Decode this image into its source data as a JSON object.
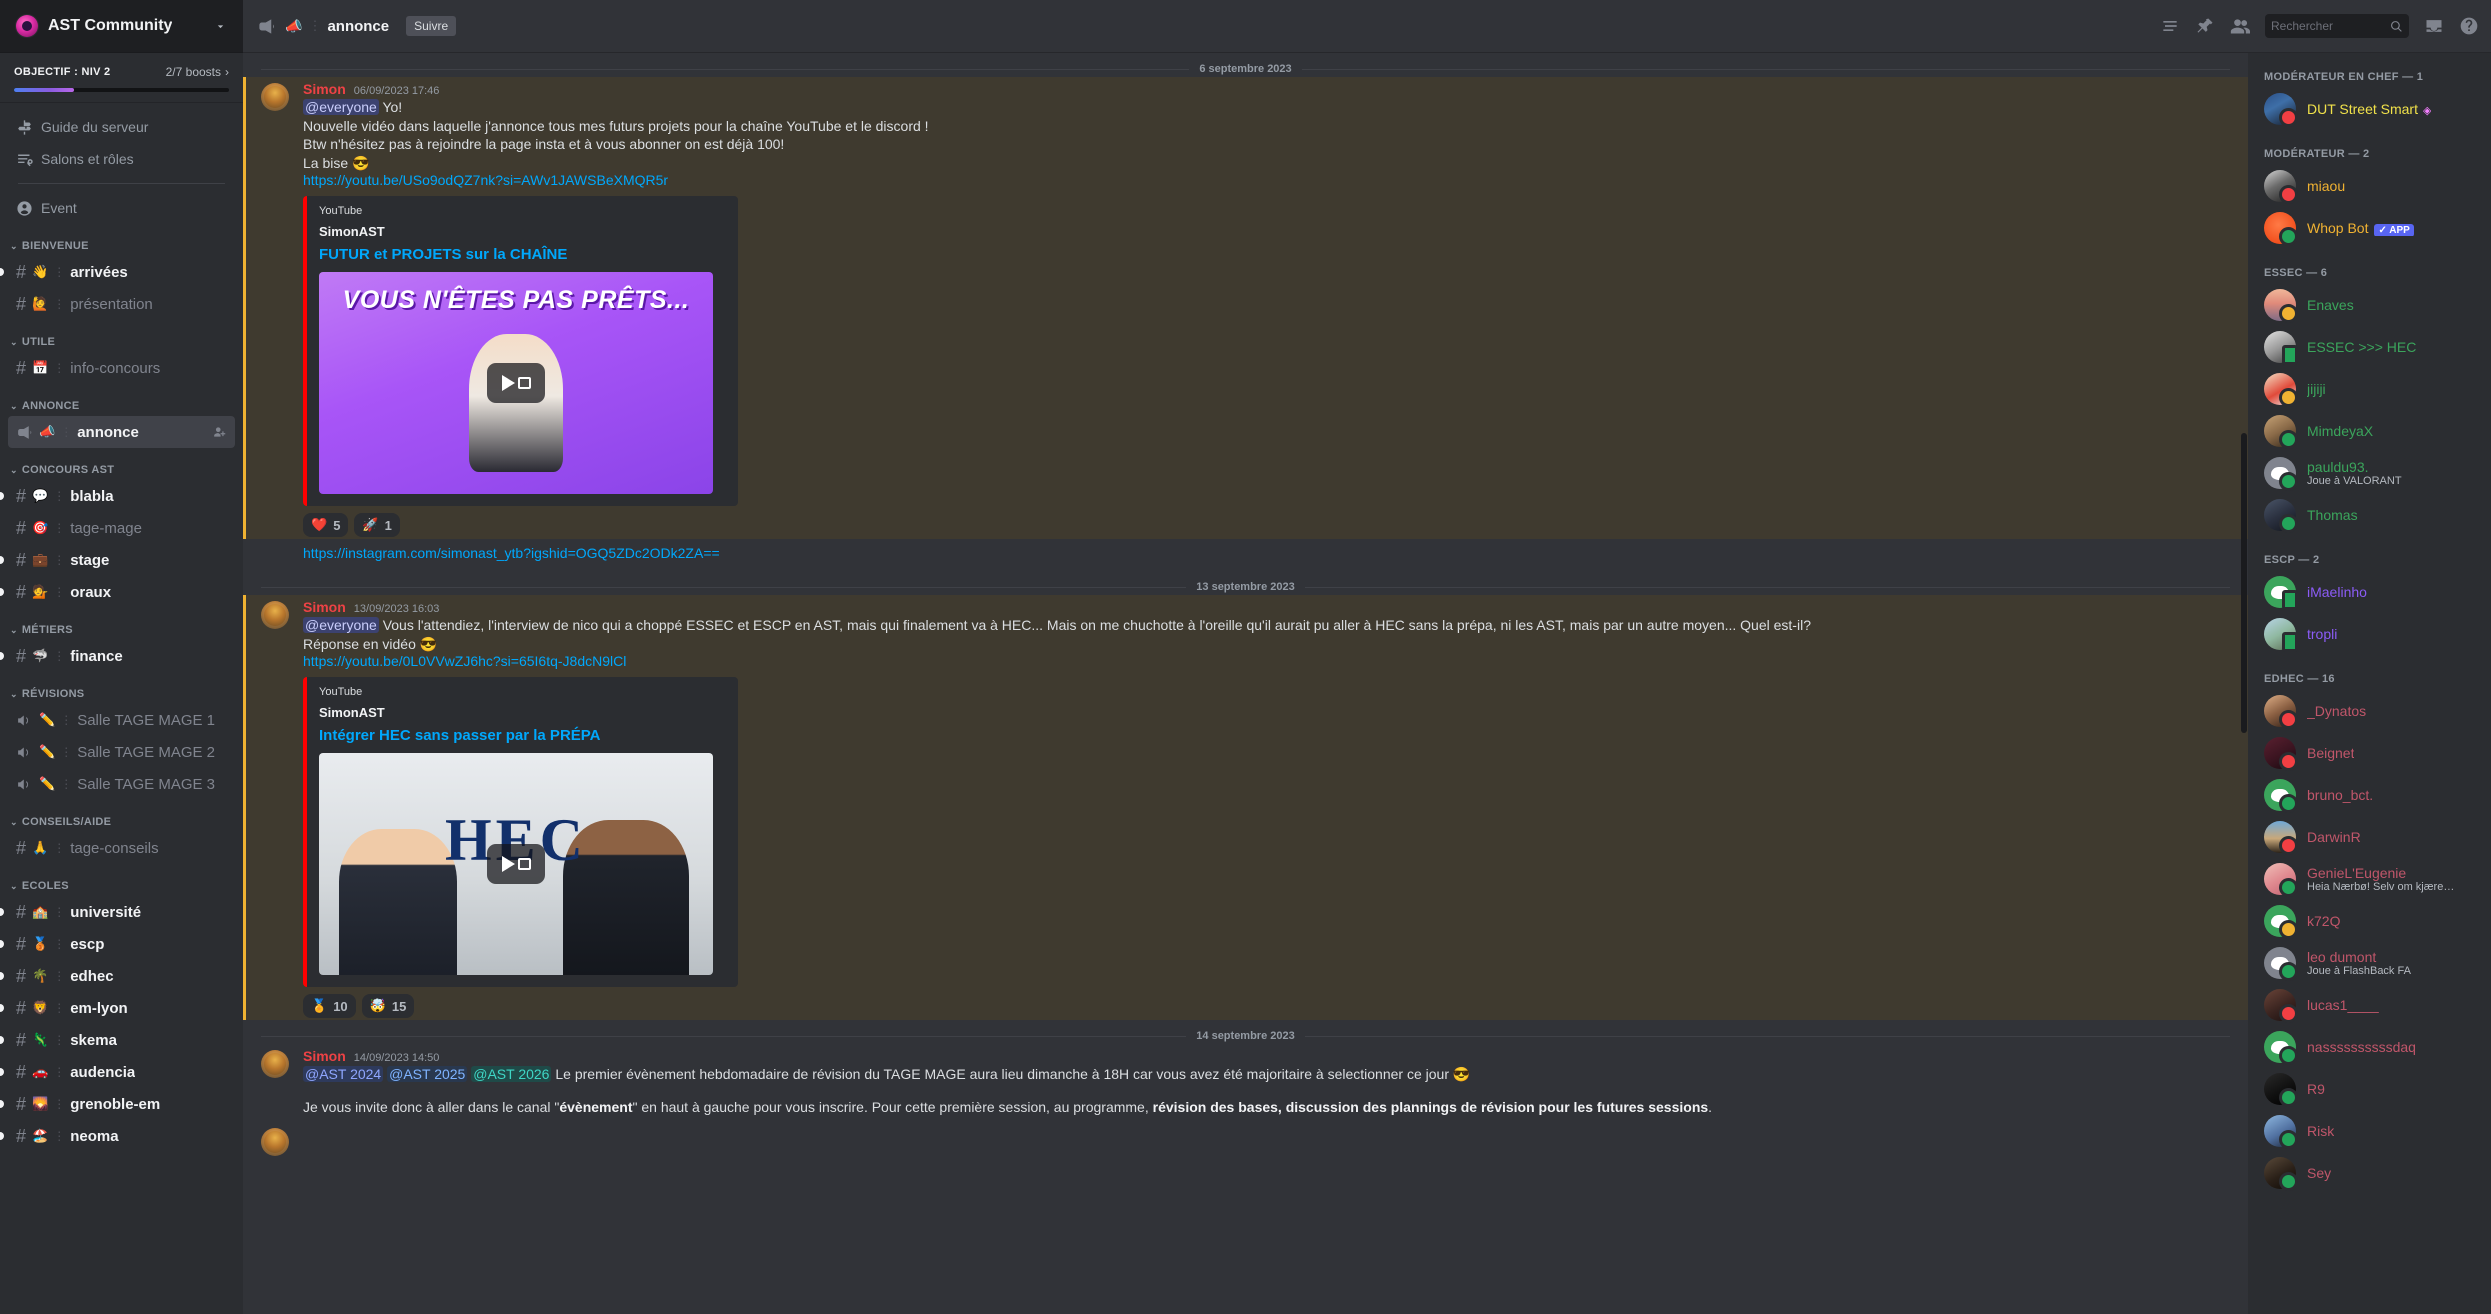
{
  "topbar": {
    "server_name": "AST Community",
    "channel_emoji": "📣",
    "channel_name": "annonce",
    "follow_label": "Suivre",
    "search_placeholder": "Rechercher",
    "icons": [
      "megaphone-icon",
      "pin-icon",
      "members-icon",
      "inbox-icon",
      "help-icon",
      "threads-icon"
    ]
  },
  "sidebar": {
    "boost": {
      "title": "OBJECTIF : NIV 2",
      "count": "2/7 boosts",
      "progress_pct": 28
    },
    "nav": [
      {
        "label": "Guide du serveur",
        "icon": "signpost-icon"
      },
      {
        "label": "Salons et rôles",
        "icon": "channels-roles-icon"
      },
      {
        "label": "Event",
        "icon": "event-icon"
      }
    ],
    "groups": [
      {
        "name": "BIENVENUE",
        "channels": [
          {
            "emoji": "👋",
            "name": "arrivées",
            "type": "text",
            "unread": true
          },
          {
            "emoji": "🙋",
            "name": "présentation",
            "type": "text",
            "unread": false
          }
        ]
      },
      {
        "name": "UTILE",
        "channels": [
          {
            "emoji": "📅",
            "name": "info-concours",
            "type": "text",
            "unread": false
          }
        ]
      },
      {
        "name": "ANNONCE",
        "channels": [
          {
            "emoji": "📣",
            "name": "annonce",
            "type": "announcement",
            "unread": true,
            "active": true,
            "trailing": "add-member-icon"
          }
        ]
      },
      {
        "name": "CONCOURS AST",
        "channels": [
          {
            "emoji": "💬",
            "name": "blabla",
            "type": "text",
            "unread": true
          },
          {
            "emoji": "🎯",
            "name": "tage-mage",
            "type": "text",
            "unread": false
          },
          {
            "emoji": "💼",
            "name": "stage",
            "type": "text",
            "unread": true
          },
          {
            "emoji": "💁",
            "name": "oraux",
            "type": "text",
            "unread": true
          }
        ]
      },
      {
        "name": "MÉTIERS",
        "channels": [
          {
            "emoji": "🦈",
            "name": "finance",
            "type": "text",
            "unread": true
          }
        ]
      },
      {
        "name": "RÉVISIONS",
        "channels": [
          {
            "emoji": "✏️",
            "name": "Salle TAGE MAGE 1",
            "type": "voice",
            "unread": false
          },
          {
            "emoji": "✏️",
            "name": "Salle TAGE MAGE 2",
            "type": "voice",
            "unread": false
          },
          {
            "emoji": "✏️",
            "name": "Salle TAGE MAGE 3",
            "type": "voice",
            "unread": false
          }
        ]
      },
      {
        "name": "CONSEILS/AIDE",
        "channels": [
          {
            "emoji": "🙏",
            "name": "tage-conseils",
            "type": "text",
            "unread": false
          }
        ]
      },
      {
        "name": "ECOLES",
        "channels": [
          {
            "emoji": "🏫",
            "name": "université",
            "type": "text",
            "unread": true
          },
          {
            "emoji": "🥉",
            "name": "escp",
            "type": "text",
            "unread": true
          },
          {
            "emoji": "🌴",
            "name": "edhec",
            "type": "text",
            "unread": true
          },
          {
            "emoji": "🦁",
            "name": "em-lyon",
            "type": "text",
            "unread": true
          },
          {
            "emoji": "🦎",
            "name": "skema",
            "type": "text",
            "unread": true
          },
          {
            "emoji": "🚗",
            "name": "audencia",
            "type": "text",
            "unread": true
          },
          {
            "emoji": "🌄",
            "name": "grenoble-em",
            "type": "text",
            "unread": true
          },
          {
            "emoji": "🏖️",
            "name": "neoma",
            "type": "text",
            "unread": true
          }
        ]
      }
    ]
  },
  "chat": {
    "date_separators": {
      "d1": "6 septembre 2023",
      "d2": "13 septembre 2023",
      "d3": "14 septembre 2023"
    },
    "messages": [
      {
        "author": "Simon",
        "timestamp": "06/09/2023 17:46",
        "mention": "@everyone",
        "line1_rest": " Yo!",
        "line2": "Nouvelle vidéo dans laquelle j'annonce tous mes futurs projets pour la chaîne YouTube et le discord !",
        "line3": "Btw n'hésitez pas à rejoindre la page insta et à vous abonner on est déjà 100!",
        "line4": "La bise 😎",
        "link": "https://youtu.be/USo9odQZ7nk?si=AWv1JAWSBeXMQR5r",
        "embed": {
          "provider": "YouTube",
          "author": "SimonAST",
          "title": "FUTUR et PROJETS sur la CHAÎNE",
          "thumb_caption": "VOUS N'ÊTES PAS PRÊTS..."
        },
        "reactions": [
          {
            "emoji": "❤️",
            "count": "5"
          },
          {
            "emoji": "🚀",
            "count": "1"
          }
        ],
        "trailing_link": "https://instagram.com/simonast_ytb?igshid=OGQ5ZDc2ODk2ZA=="
      },
      {
        "author": "Simon",
        "timestamp": "13/09/2023 16:03",
        "mention": "@everyone",
        "line1_rest": " Vous l'attendiez, l'interview de nico qui a choppé ESSEC et ESCP en AST, mais qui finalement va à HEC... Mais on me chuchotte à l'oreille qu'il aurait pu aller à HEC sans la prépa, ni les AST, mais par un autre moyen... Quel est-il?",
        "line2": "Réponse en vidéo 😎",
        "link": "https://youtu.be/0L0VVwZJ6hc?si=65I6tq-J8dcN9lCl",
        "embed": {
          "provider": "YouTube",
          "author": "SimonAST",
          "title": "Intégrer HEC sans passer par la PRÉPA",
          "thumb_caption": "HEC"
        },
        "reactions": [
          {
            "emoji": "🏅",
            "count": "10"
          },
          {
            "emoji": "🤯",
            "count": "15"
          }
        ]
      },
      {
        "author": "Simon",
        "timestamp": "14/09/2023 14:50",
        "role_mentions": [
          "@AST 2024",
          "@AST 2025",
          "@AST 2026"
        ],
        "line1_rest": " Le premier évènement hebdomadaire de révision du TAGE MAGE aura lieu dimanche à 18H car vous avez été majoritaire à selectionner ce jour 😎",
        "line2_pre": "Je vous invite donc à aller dans le canal \"",
        "line2_b1": "évènement",
        "line2_mid": "\" en haut à gauche pour vous inscrire. Pour cette première session, au programme, ",
        "line2_b2": "révision des bases, discussion des plannings de révision pour les futures sessions",
        "line2_end": "."
      }
    ]
  },
  "members": {
    "groups": [
      {
        "title": "MODÉRATEUR EN CHEF — 1",
        "members": [
          {
            "name": "DUT Street Smart",
            "color": "#f0e14a",
            "status": "dnd",
            "avatar": "photo-blue",
            "gem": "◈"
          }
        ]
      },
      {
        "title": "MODÉRATEUR — 2",
        "members": [
          {
            "name": "miaou",
            "color": "#f0b232",
            "status": "dnd",
            "avatar": "photo-bw"
          },
          {
            "name": "Whop Bot",
            "color": "#f0b232",
            "status": "online",
            "avatar": "orange",
            "badge": "APP"
          }
        ]
      },
      {
        "title": "ESSEC — 6",
        "members": [
          {
            "name": "Enaves",
            "color": "#3ba55c",
            "status": "idle",
            "avatar": "photo-sunset"
          },
          {
            "name": "ESSEC >>> HEC",
            "color": "#3ba55c",
            "status": "mobile",
            "avatar": "photo-gray"
          },
          {
            "name": "jijiji",
            "color": "#3ba55c",
            "status": "idle",
            "avatar": "photo-red"
          },
          {
            "name": "MimdeyaX",
            "color": "#3ba55c",
            "status": "online",
            "avatar": "photo-tan"
          },
          {
            "name": "pauldu93.",
            "color": "#3ba55c",
            "status": "online",
            "avatar": "discord-gray",
            "sub": "Joue à VALORANT"
          },
          {
            "name": "Thomas",
            "color": "#3ba55c",
            "status": "online",
            "avatar": "photo-dark"
          }
        ]
      },
      {
        "title": "ESCP — 2",
        "members": [
          {
            "name": "iMaelinho",
            "color": "#8b5cf6",
            "status": "mobile",
            "avatar": "discord-green"
          },
          {
            "name": "tropli",
            "color": "#8b5cf6",
            "status": "mobile",
            "avatar": "photo-light"
          }
        ]
      },
      {
        "title": "EDHEC — 16",
        "members": [
          {
            "name": "_Dynatos",
            "color": "#c0566a",
            "status": "dnd",
            "avatar": "photo-warm"
          },
          {
            "name": "Beignet",
            "color": "#c0566a",
            "status": "dnd",
            "avatar": "photo-maroon"
          },
          {
            "name": "bruno_bct.",
            "color": "#c0566a",
            "status": "online",
            "avatar": "discord-green"
          },
          {
            "name": "DarwinR",
            "color": "#c0566a",
            "status": "dnd",
            "avatar": "photo-sky"
          },
          {
            "name": "GenieL'Eugenie",
            "color": "#c0566a",
            "status": "online",
            "avatar": "photo-pink",
            "sub": "Heia Nærbø! Selv om kjærest..."
          },
          {
            "name": "k72Q",
            "color": "#c0566a",
            "status": "idle",
            "avatar": "discord-green"
          },
          {
            "name": "leo dumont",
            "color": "#c0566a",
            "status": "online",
            "avatar": "discord-gray",
            "sub": "Joue à FlashBack FA"
          },
          {
            "name": "lucas1____",
            "color": "#c0566a",
            "status": "dnd",
            "avatar": "photo-dim"
          },
          {
            "name": "nassssssssssdaq",
            "color": "#c0566a",
            "status": "online",
            "avatar": "discord-green"
          },
          {
            "name": "R9",
            "color": "#c0566a",
            "status": "online",
            "avatar": "photo-black"
          },
          {
            "name": "Risk",
            "color": "#c0566a",
            "status": "online",
            "avatar": "photo-blue2"
          },
          {
            "name": "Sey",
            "color": "#c0566a",
            "status": "online",
            "avatar": "photo-dark2"
          }
        ]
      }
    ]
  }
}
